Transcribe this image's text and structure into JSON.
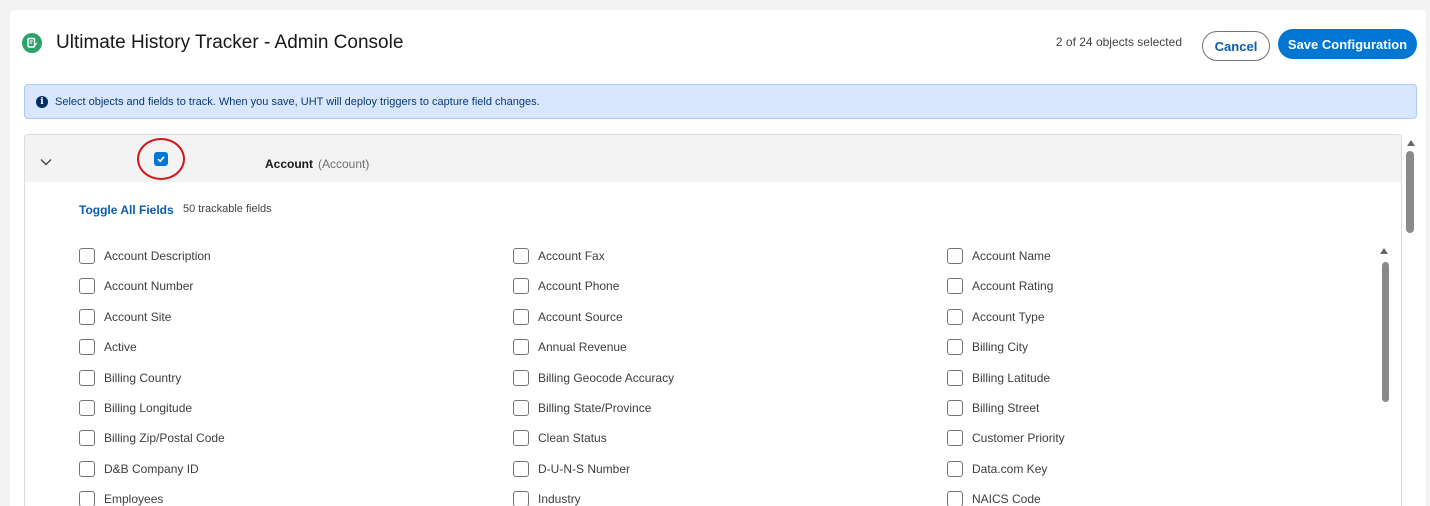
{
  "header": {
    "title": "Ultimate History Tracker - Admin Console",
    "logo_icon": "edit-document-icon",
    "selected_count": "2 of 24 objects selected",
    "cancel_label": "Cancel",
    "save_label": "Save Configuration"
  },
  "info_banner": {
    "text": "Select objects and fields to track. When you save, UHT will deploy triggers to capture field changes."
  },
  "object": {
    "name": "Account",
    "api_name": "(Account)",
    "selected": true,
    "expanded": true,
    "toggle_all_label": "Toggle All Fields",
    "trackable_text": "50 trackable fields",
    "fields": [
      "Account Description",
      "Account Fax",
      "Account Name",
      "Account Number",
      "Account Phone",
      "Account Rating",
      "Account Site",
      "Account Source",
      "Account Type",
      "Active",
      "Annual Revenue",
      "Billing City",
      "Billing Country",
      "Billing Geocode Accuracy",
      "Billing Latitude",
      "Billing Longitude",
      "Billing State/Province",
      "Billing Street",
      "Billing Zip/Postal Code",
      "Clean Status",
      "Customer Priority",
      "D&B Company ID",
      "D-U-N-S Number",
      "Data.com Key",
      "Employees",
      "Industry",
      "NAICS Code"
    ]
  },
  "colors": {
    "brand": "#0176d3",
    "logo": "#2ea26b",
    "banner_bg": "#d8e6fe",
    "highlight_circle": "#d11a1a"
  }
}
